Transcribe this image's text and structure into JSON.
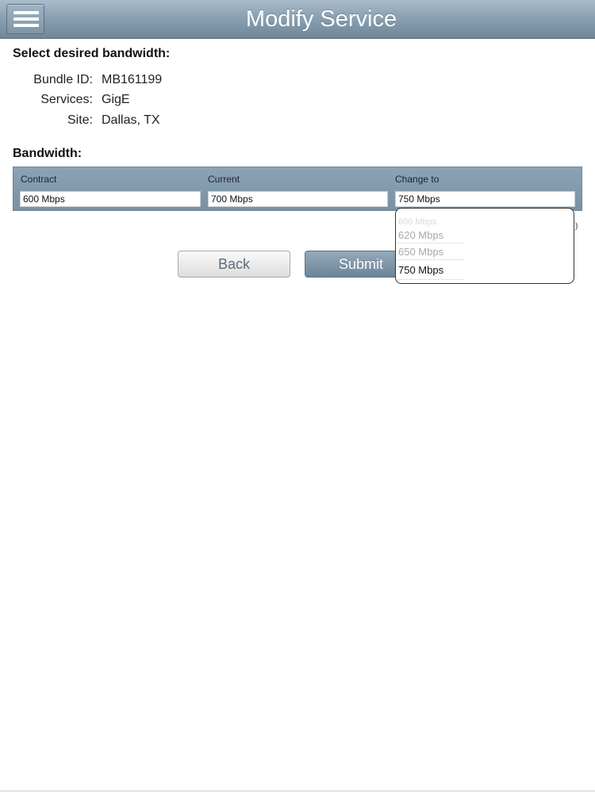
{
  "header": {
    "title": "Modify Service",
    "menu_icon": "hamburger-menu-icon"
  },
  "details": {
    "heading": "Select desired bandwidth:",
    "bundle_id_label": "Bundle ID:",
    "bundle_id_value": "MB161199",
    "services_label": "Services:",
    "services_value": "GigE",
    "site_label": "Site:",
    "site_value": "Dallas, TX"
  },
  "bandwidth": {
    "heading": "Bandwidth:",
    "contract_label": "Contract",
    "contract_value": "600 Mbps",
    "current_label": "Current",
    "current_value": "700 Mbps",
    "change_label": "Change to",
    "change_value": "750 Mbps"
  },
  "picker": {
    "options": [
      "600 Mbps",
      "620 Mbps",
      "650 Mbps",
      "750 Mbps"
    ],
    "selected": "750 Mbps"
  },
  "buttons": {
    "back": "Back",
    "submit": "Submit"
  },
  "edge_glyph": ")",
  "colors": {
    "header": "#8aa1b3",
    "panel": "#8099ad",
    "submit": "#7890a3"
  }
}
